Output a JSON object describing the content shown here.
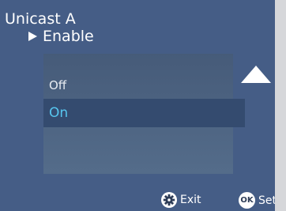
{
  "header": {
    "title": "Unicast A",
    "subtitle": "Enable"
  },
  "list": {
    "items": [
      {
        "label": "Off",
        "selected": false
      },
      {
        "label": "On",
        "selected": true
      }
    ]
  },
  "footer": {
    "exit_label": "Exit",
    "set_label": "Set",
    "ok_badge": "OK"
  },
  "colors": {
    "background": "#455d86",
    "selected_text": "#57c6ef",
    "selected_row": "#344b6f"
  },
  "icons": {
    "pointer": "triangle-right-icon",
    "scroll": "triangle-up-icon",
    "exit": "gear-icon",
    "set": "ok-icon"
  }
}
